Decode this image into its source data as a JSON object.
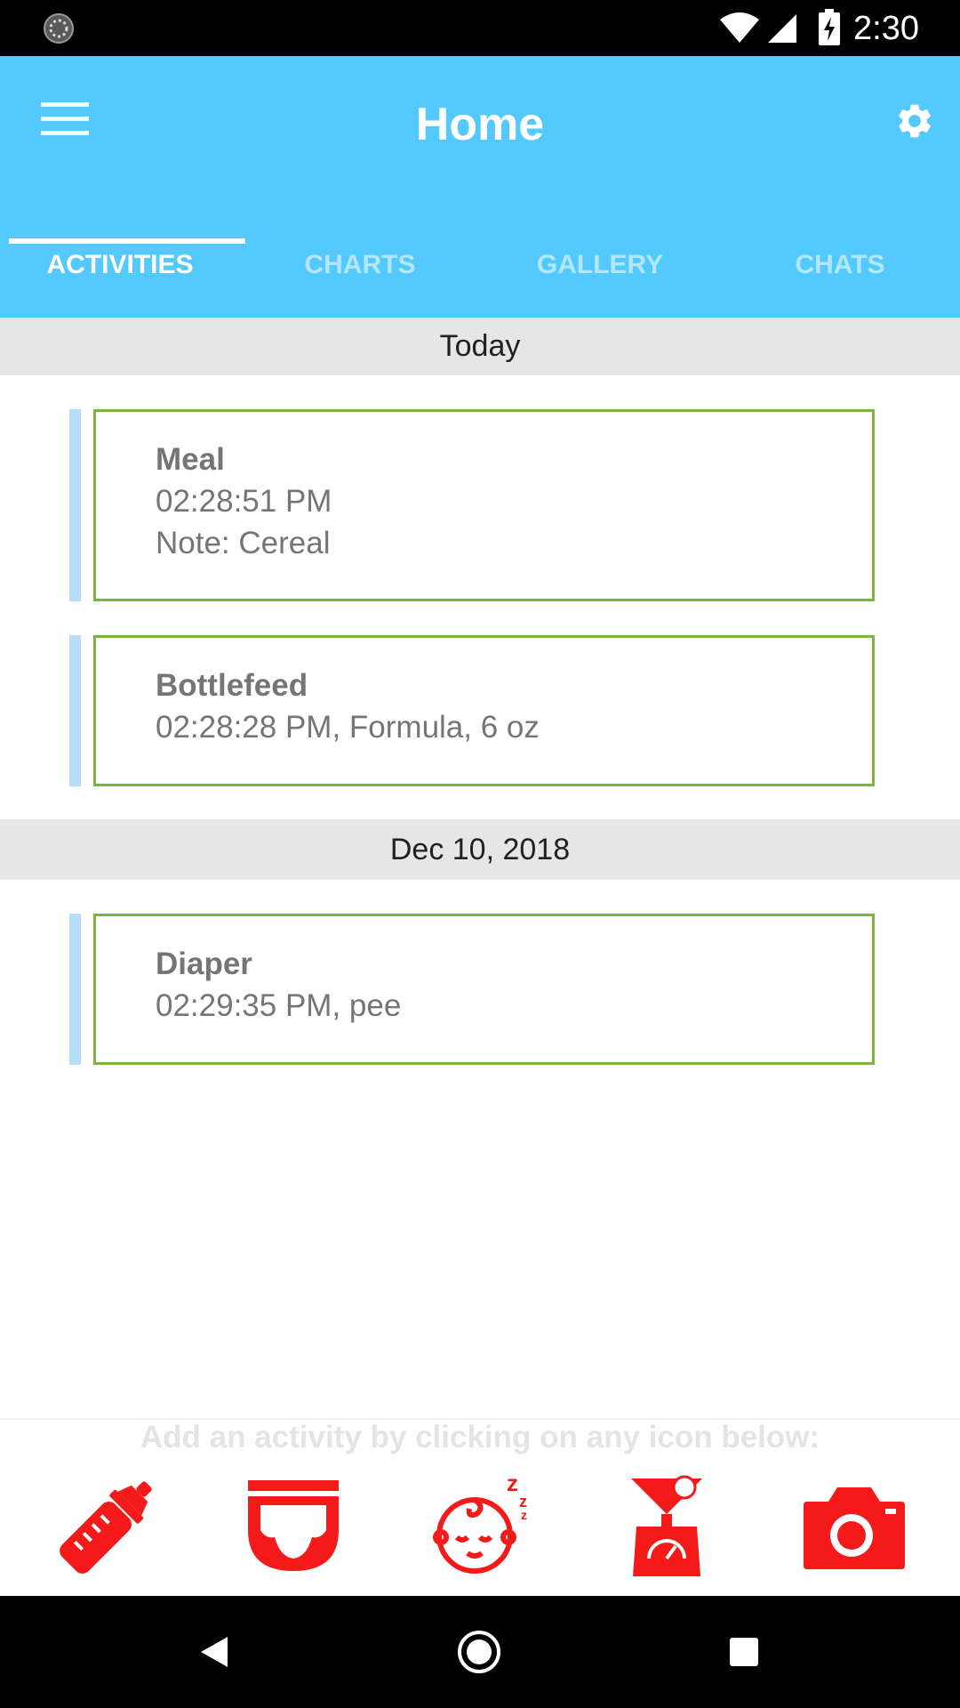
{
  "status_bar": {
    "time": "2:30",
    "icons": [
      "loading-spinner-icon",
      "wifi-icon",
      "signal-icon",
      "battery-charging-icon"
    ]
  },
  "header": {
    "title": "Home",
    "menu_icon": "hamburger-menu-icon",
    "settings_icon": "gear-icon"
  },
  "tabs": [
    {
      "label": "ACTIVITIES",
      "active": true
    },
    {
      "label": "CHARTS",
      "active": false
    },
    {
      "label": "GALLERY",
      "active": false
    },
    {
      "label": "CHATS",
      "active": false
    }
  ],
  "sections": [
    {
      "date": "Today",
      "entries": [
        {
          "title": "Meal",
          "lines": [
            "02:28:51 PM",
            "Note: Cereal"
          ]
        },
        {
          "title": "Bottlefeed",
          "lines": [
            "02:28:28 PM, Formula, 6 oz"
          ]
        }
      ]
    },
    {
      "date": "Dec 10, 2018",
      "entries": [
        {
          "title": "Diaper",
          "lines": [
            "02:29:35 PM, pee"
          ]
        }
      ]
    }
  ],
  "bottom": {
    "hint": "Add an activity by clicking on any icon below:",
    "icons": [
      "baby-bottle-icon",
      "diaper-icon",
      "sleeping-baby-icon",
      "weight-scale-icon",
      "camera-icon"
    ],
    "icon_color": "#f41a1a"
  },
  "colors": {
    "app_bar": "#54c9fd",
    "card_border": "#7cb342",
    "card_accent": "#b6def6",
    "section_header_bg": "#e6e6e6"
  },
  "nav_bar": {
    "icons": [
      "back-icon",
      "home-icon",
      "recents-icon"
    ]
  }
}
